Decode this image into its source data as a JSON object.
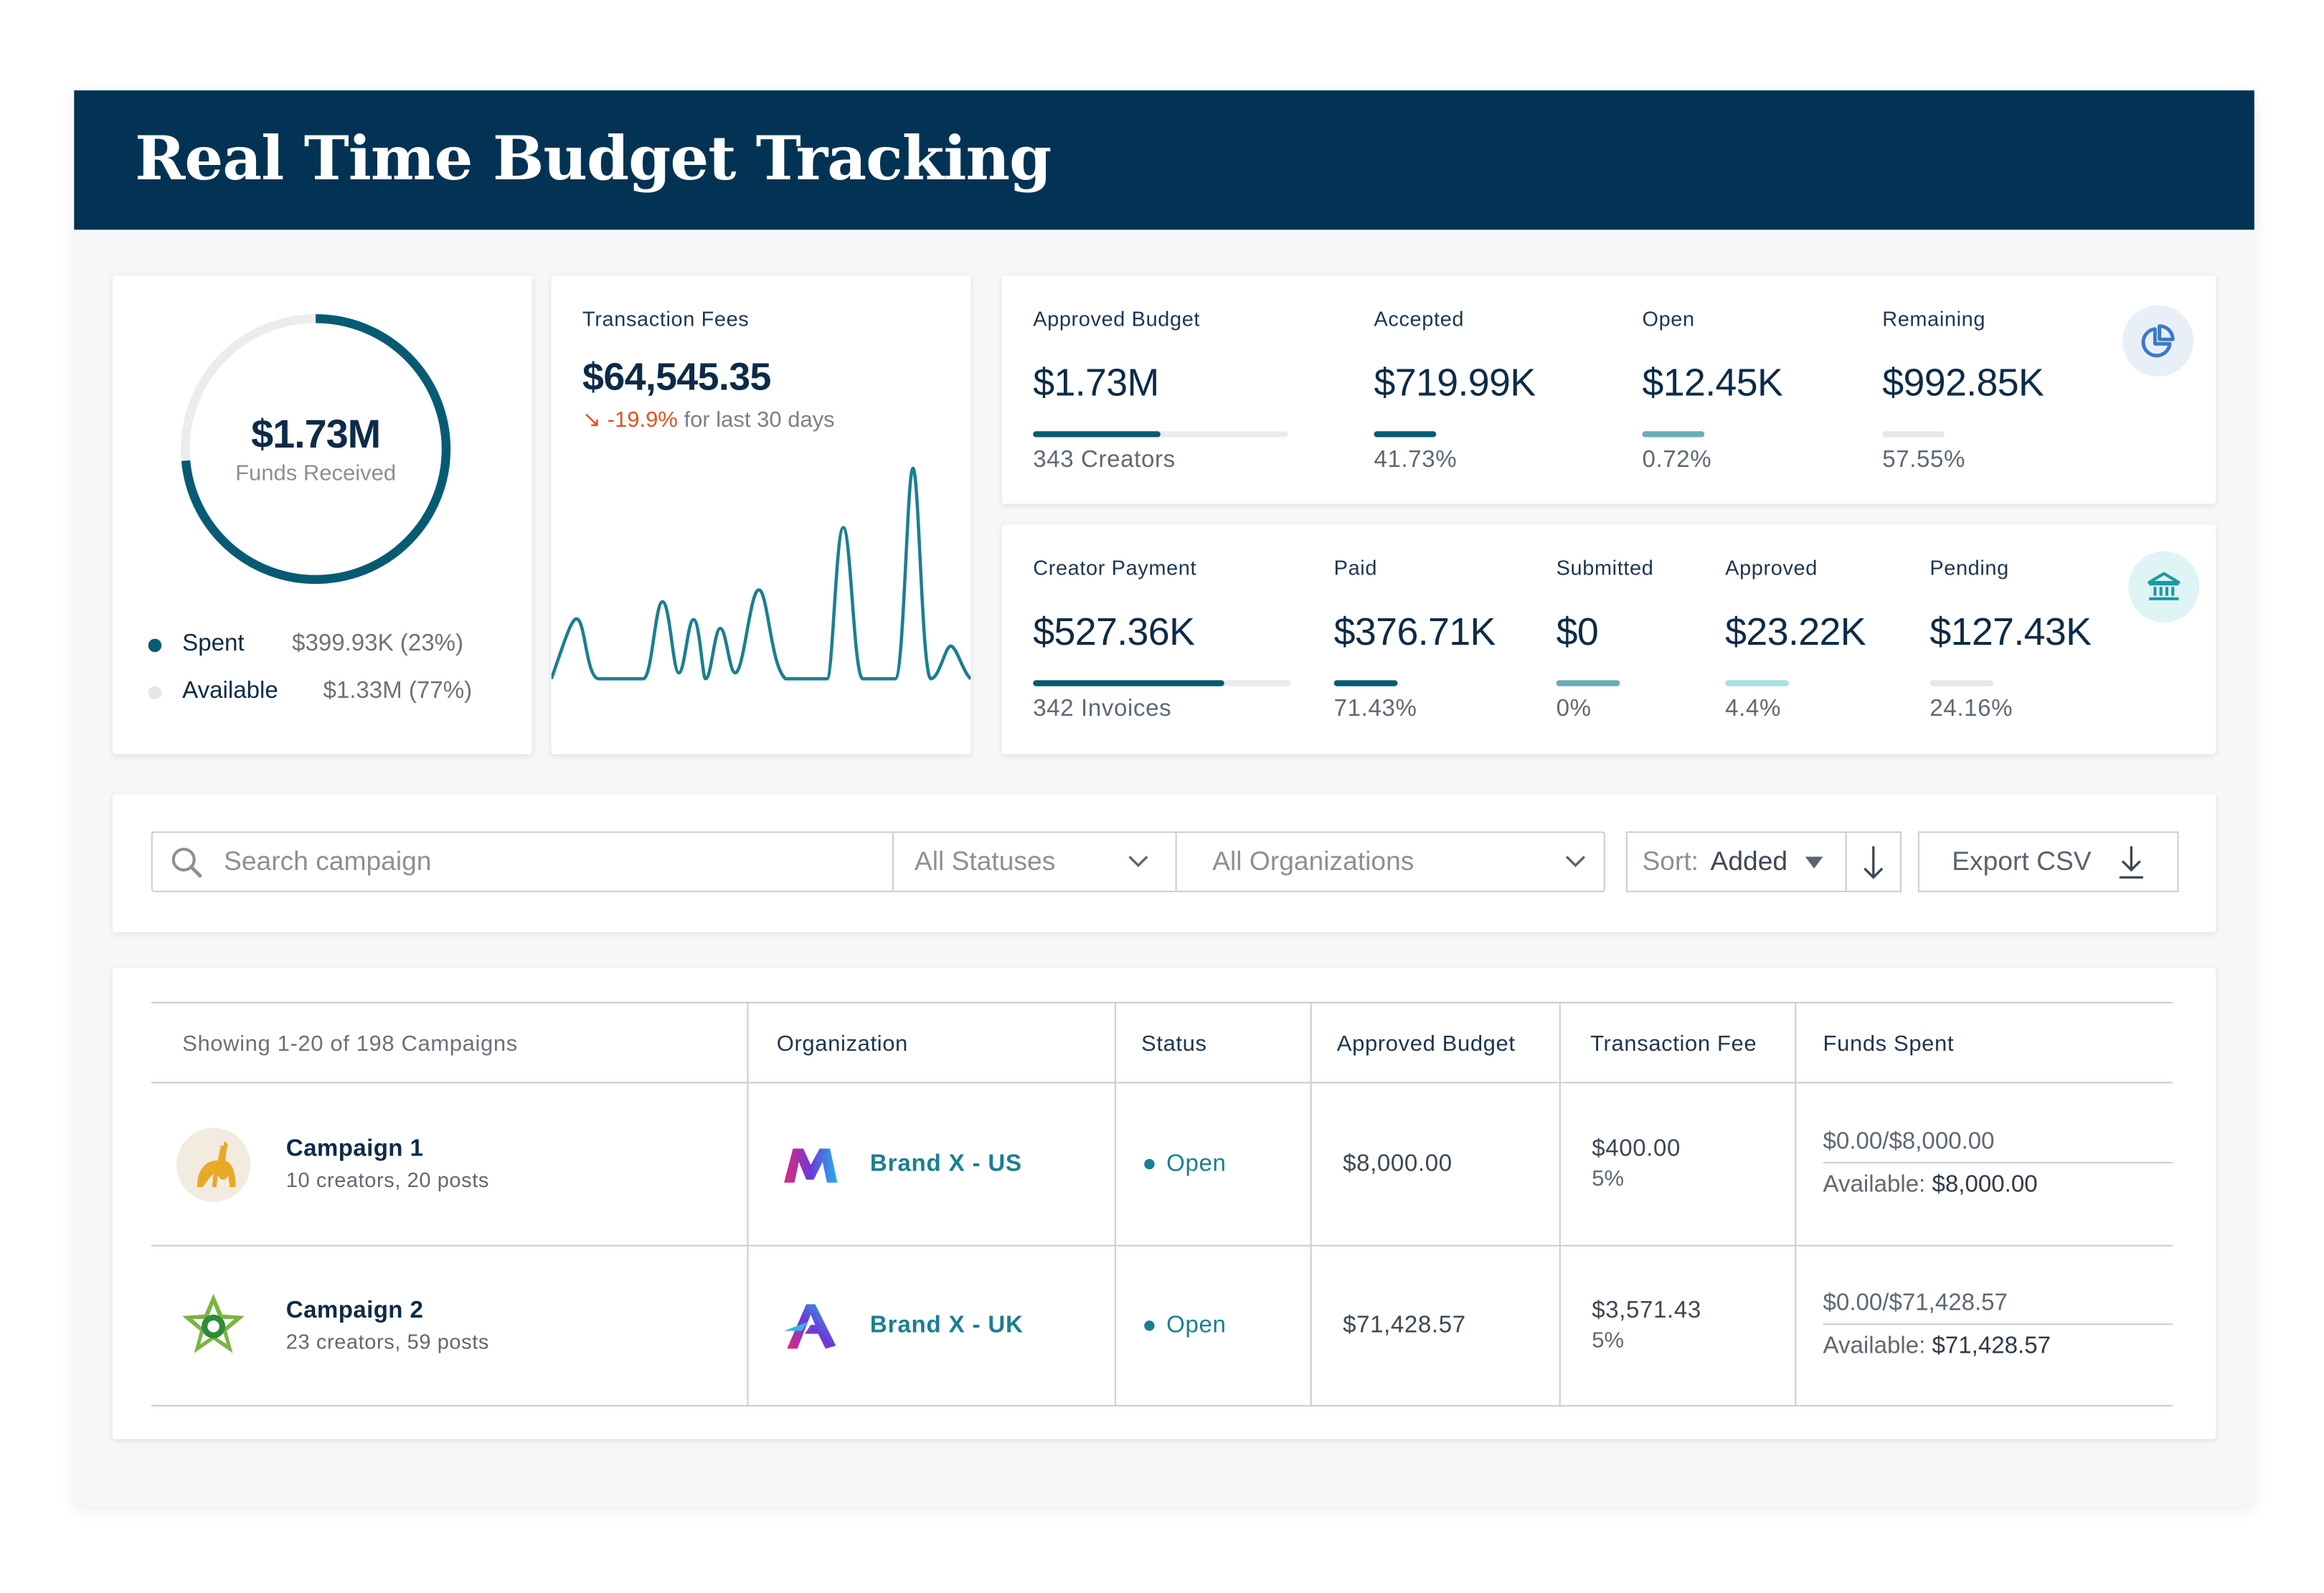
{
  "header": {
    "title": "Real Time Budget Tracking"
  },
  "funds": {
    "amount": "$1.73M",
    "label": "Funds Received",
    "spent_fraction": 0.23,
    "legend": [
      {
        "name": "Spent",
        "value": "$399.93K (23%)",
        "color": "#065b73"
      },
      {
        "name": "Available",
        "value": "$1.33M (77%)",
        "color": "#e6e7e9"
      }
    ]
  },
  "fees": {
    "label": "Transaction Fees",
    "amount": "$64,545.35",
    "change_icon": "arrow-down-right-icon",
    "change": "-19.9%",
    "period": "for last 30 days",
    "color": "#1b7f90"
  },
  "budget_stats": {
    "icon": "pie-chart-icon",
    "items": [
      {
        "label": "Approved Budget",
        "value": "$1.73M",
        "sub": "343 Creators",
        "fill": 0.5,
        "color": "#065b73"
      },
      {
        "label": "Accepted",
        "value": "$719.99K",
        "sub": "41.73%",
        "fill": 0.4173,
        "color": "#065b73"
      },
      {
        "label": "Open",
        "value": "$12.45K",
        "sub": "0.72%",
        "fill": 0.72,
        "color": "#6aacb5"
      },
      {
        "label": "Remaining",
        "value": "$992.85K",
        "sub": "57.55%",
        "fill": 0.5755,
        "color": "#e6e7e9"
      }
    ]
  },
  "payment_stats": {
    "icon": "bank-icon",
    "items": [
      {
        "label": "Creator Payment",
        "value": "$527.36K",
        "sub": "342 Invoices",
        "fill": 0.74,
        "color": "#065b73"
      },
      {
        "label": "Paid",
        "value": "$376.71K",
        "sub": "71.43%",
        "fill": 0.7143,
        "color": "#065b73"
      },
      {
        "label": "Submitted",
        "value": "$0",
        "sub": "0%",
        "fill": 1.0,
        "color": "#6aacb5"
      },
      {
        "label": "Approved",
        "value": "$23.22K",
        "sub": "4.4%",
        "fill": 0.6,
        "color": "#a8dfe4"
      },
      {
        "label": "Pending",
        "value": "$127.43K",
        "sub": "24.16%",
        "fill": 0.2416,
        "color": "#e6e7e9"
      }
    ]
  },
  "filters": {
    "search_placeholder": "Search campaign",
    "status": "All Statuses",
    "organization": "All Organizations",
    "sort_label": "Sort:",
    "sort_value": "Added",
    "export_label": "Export CSV"
  },
  "table": {
    "columns": [
      "Showing 1-20 of 198 Campaigns",
      "Organization",
      "Status",
      "Approved Budget",
      "Transaction Fee",
      "Funds Spent"
    ],
    "rows": [
      {
        "name": "Campaign 1",
        "sub": "10 creators, 20 posts",
        "avatar": "giraffe-logo-icon",
        "org": "Brand X - US",
        "org_logo": "brand-m-logo-icon",
        "status": "Open",
        "budget": "$8,000.00",
        "fee": "$400.00",
        "fee_pct": "5%",
        "spent": "$0.00/$8,000.00",
        "available_label": "Available:",
        "available": "$8,000.00"
      },
      {
        "name": "Campaign 2",
        "sub": "23 creators, 59 posts",
        "avatar": "flower-logo-icon",
        "org": "Brand X - UK",
        "org_logo": "brand-a-logo-icon",
        "status": "Open",
        "budget": "$71,428.57",
        "fee": "$3,571.43",
        "fee_pct": "5%",
        "spent": "$0.00/$71,428.57",
        "available_label": "Available:",
        "available": "$71,428.57"
      }
    ]
  }
}
